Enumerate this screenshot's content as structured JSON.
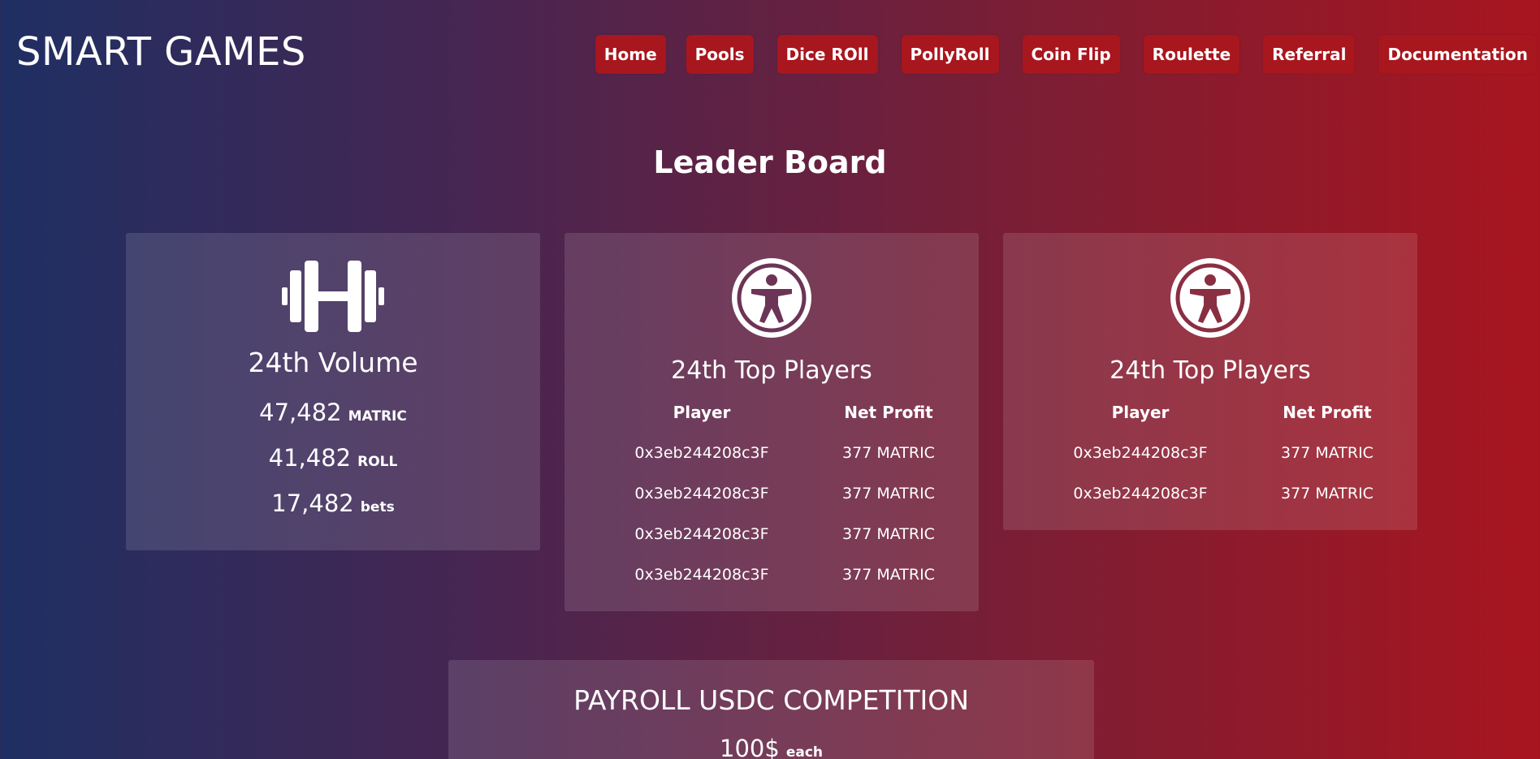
{
  "brand": "SMART GAMES",
  "nav": {
    "items": [
      "Home",
      "Pools",
      "Dice ROll",
      "PollyRoll",
      "Coin Flip",
      "Roulette",
      "Referral",
      "Documentation"
    ]
  },
  "page_title": "Leader Board",
  "volume": {
    "icon": "dumbbell-icon",
    "title": "24th Volume",
    "stats": [
      {
        "value": "47,482",
        "unit": "MATRIC"
      },
      {
        "value": "41,482",
        "unit": "ROLL"
      },
      {
        "value": "17,482",
        "unit": "bets"
      }
    ]
  },
  "top_players_1": {
    "icon": "accessibility-icon",
    "title": "24th Top Players",
    "col_player": "Player",
    "col_profit": "Net Profit",
    "rows": [
      {
        "player": "0x3eb244208c3F",
        "profit": "377 MATRIC"
      },
      {
        "player": "0x3eb244208c3F",
        "profit": "377 MATRIC"
      },
      {
        "player": "0x3eb244208c3F",
        "profit": "377 MATRIC"
      },
      {
        "player": "0x3eb244208c3F",
        "profit": "377 MATRIC"
      }
    ]
  },
  "top_players_2": {
    "icon": "accessibility-icon",
    "title": "24th Top Players",
    "col_player": "Player",
    "col_profit": "Net Profit",
    "rows": [
      {
        "player": "0x3eb244208c3F",
        "profit": "377 MATRIC"
      },
      {
        "player": "0x3eb244208c3F",
        "profit": "377 MATRIC"
      }
    ]
  },
  "payroll": {
    "title": "PAYROLL USDC COMPETITION",
    "value": "100$",
    "unit": "each"
  },
  "colors": {
    "accent": "#a8161e",
    "gradient_start": "#1f2f63",
    "gradient_end": "#a8151f"
  }
}
